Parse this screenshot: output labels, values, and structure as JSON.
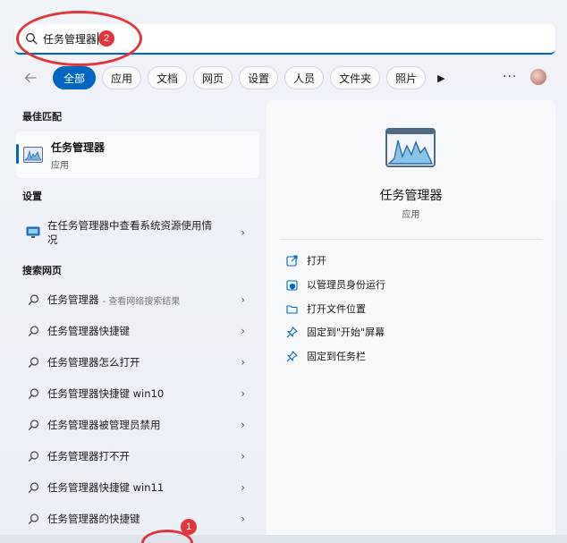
{
  "search": {
    "query": "任务管理器"
  },
  "annotations": {
    "badge_search": "2",
    "badge_taskbar": "1"
  },
  "filters": {
    "tabs": [
      "全部",
      "应用",
      "文档",
      "网页",
      "设置",
      "人员",
      "文件夹",
      "照片"
    ],
    "more_label": "···"
  },
  "best_match": {
    "heading": "最佳匹配",
    "title": "任务管理器",
    "subtitle": "应用"
  },
  "settings": {
    "heading": "设置",
    "item": "在任务管理器中查看系统资源使用情况"
  },
  "web": {
    "heading": "搜索网页",
    "items": [
      {
        "text": "任务管理器",
        "hint": "- 查看网络搜索结果"
      },
      {
        "text": "任务管理器快捷键",
        "hint": ""
      },
      {
        "text": "任务管理器怎么打开",
        "hint": ""
      },
      {
        "text": "任务管理器快捷键 win10",
        "hint": ""
      },
      {
        "text": "任务管理器被管理员禁用",
        "hint": ""
      },
      {
        "text": "任务管理器打不开",
        "hint": ""
      },
      {
        "text": "任务管理器快捷键 win11",
        "hint": ""
      },
      {
        "text": "任务管理器的快捷键",
        "hint": ""
      }
    ]
  },
  "detail": {
    "title": "任务管理器",
    "subtitle": "应用",
    "actions": [
      "打开",
      "以管理员身份运行",
      "打开文件位置",
      "固定到\"开始\"屏幕",
      "固定到任务栏"
    ]
  },
  "colors": {
    "accent": "#0067c0",
    "annotation": "#e0373c"
  }
}
